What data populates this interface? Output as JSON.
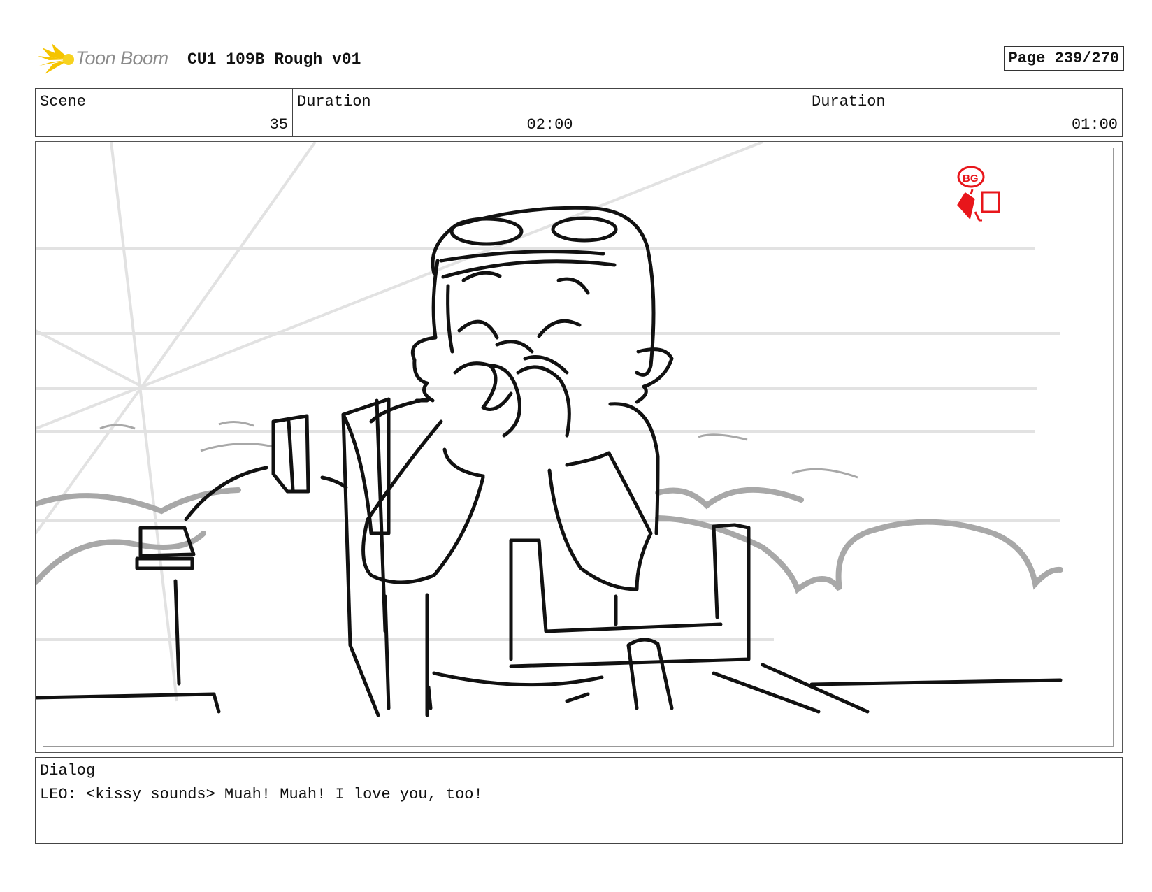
{
  "header": {
    "brand": "Toon Boom",
    "title": "CU1 109B Rough v01",
    "page_label": "Page 239/270"
  },
  "info": {
    "scene_label": "Scene",
    "scene_value": "35",
    "duration1_label": "Duration",
    "duration1_value": "02:00",
    "duration2_label": "Duration",
    "duration2_value": "01:00"
  },
  "panel": {
    "bg_mark": "BG",
    "sketch_subject": "rough-storyboard-sketch",
    "stamp_color": "#e8161b"
  },
  "dialog": {
    "label": "Dialog",
    "text": "LEO: <kissy sounds> Muah! Muah! I love you, too!"
  }
}
